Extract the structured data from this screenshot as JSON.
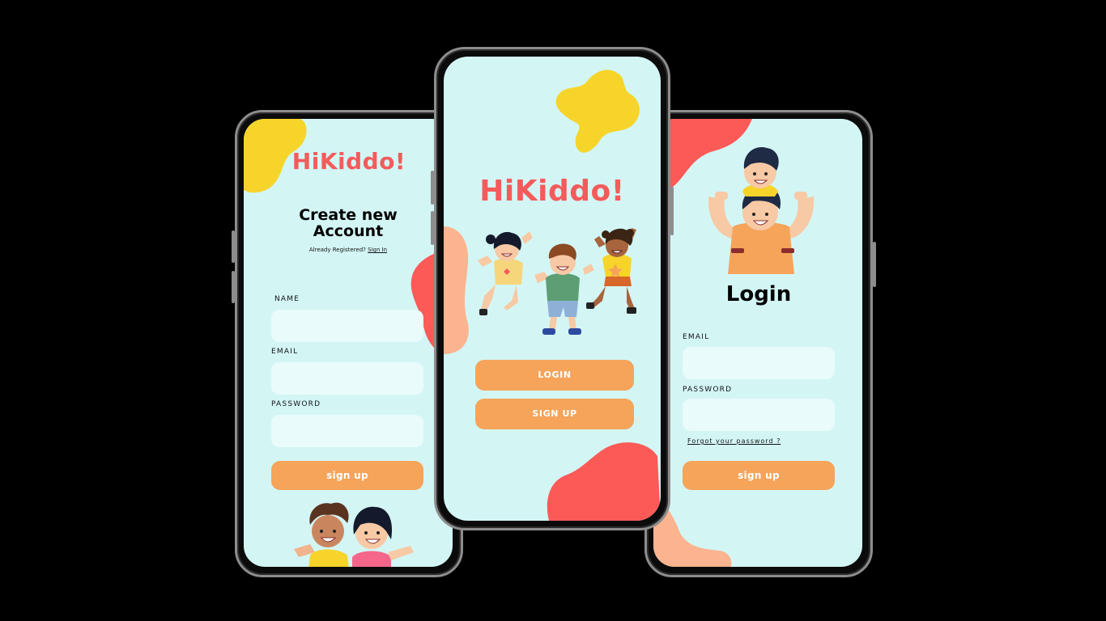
{
  "colors": {
    "brand": "#f45b5b",
    "button": "#f5a45a",
    "screen_bg": "#d3f6f5",
    "field_bg": "#e9fbfb",
    "yellow_blob": "#f6d42a",
    "red_blob": "#fb5a57",
    "peach_blob": "#fbb48f"
  },
  "signup_screen": {
    "brand": "HiKiddo!",
    "title_line1": "Create new",
    "title_line2": "Account",
    "already_text": "Already Registered?",
    "sign_in_link": "Sign In",
    "name_label": "NAME",
    "email_label": "EMAIL",
    "password_label": "PASSWORD",
    "submit_label": "sign up",
    "illustration": "kids-waving-illustration"
  },
  "welcome_screen": {
    "brand": "HiKiddo!",
    "login_button": "LOGIN",
    "signup_button": "SIGN UP",
    "illustration": "three-kids-jumping-illustration"
  },
  "login_screen": {
    "title": "Login",
    "email_label": "EMAIL",
    "password_label": "PASSWORD",
    "forgot_link": "Forgot your password ?",
    "submit_label": "sign up",
    "illustration": "father-child-shoulders-illustration"
  }
}
